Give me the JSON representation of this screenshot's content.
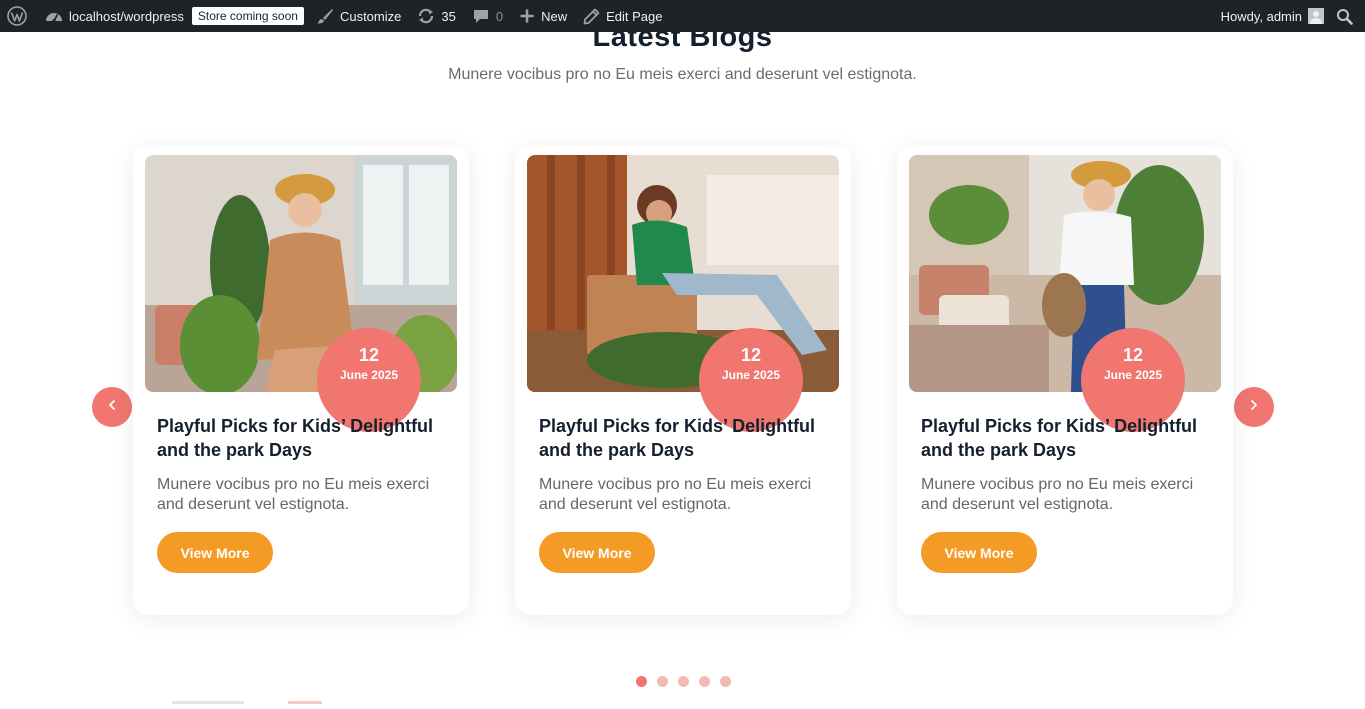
{
  "adminbar": {
    "site": "localhost/wordpress",
    "store_badge": "Store coming soon",
    "customize": "Customize",
    "updates_count": "35",
    "comments_count": "0",
    "new": "New",
    "edit_page": "Edit Page",
    "howdy": "Howdy, admin"
  },
  "section": {
    "title": "Latest Blogs",
    "subtitle": "Munere vocibus pro no Eu meis exerci and deserunt vel estignota."
  },
  "cards": [
    {
      "day": "12",
      "month": "June 2025",
      "title": "Playful Picks for Kids’ Delightful and the park Days",
      "text": "Munere vocibus pro no Eu meis exerci and deserunt vel estignota.",
      "button": "View More"
    },
    {
      "day": "12",
      "month": "June 2025",
      "title": "Playful Picks for Kids’ Delightful and the park Days",
      "text": "Munere vocibus pro no Eu meis exerci and deserunt vel estignota.",
      "button": "View More"
    },
    {
      "day": "12",
      "month": "June 2025",
      "title": "Playful Picks for Kids’ Delightful and the park Days",
      "text": "Munere vocibus pro no Eu meis exerci and deserunt vel estignota.",
      "button": "View More"
    }
  ],
  "slider": {
    "total_pages": 5,
    "active_page": 1
  },
  "colors": {
    "accent": "#f0766f",
    "button": "#f39b24",
    "adminbar": "#1d2327",
    "heading": "#14202e"
  },
  "icons": {
    "prev": "chevron-left-icon",
    "next": "chevron-right-icon"
  }
}
